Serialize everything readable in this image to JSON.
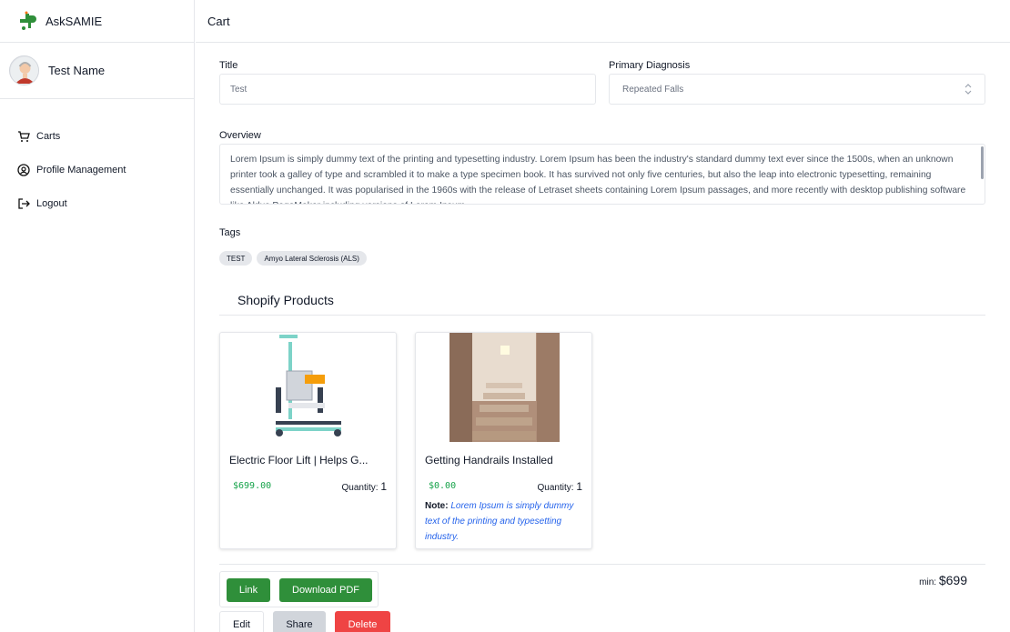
{
  "app": {
    "name": "AskSAMIE"
  },
  "user": {
    "name": "Test Name"
  },
  "nav": [
    {
      "label": "Carts",
      "icon": "cart-icon"
    },
    {
      "label": "Profile Management",
      "icon": "user-circle-icon"
    },
    {
      "label": "Logout",
      "icon": "logout-icon"
    }
  ],
  "header": {
    "title": "Cart"
  },
  "form": {
    "title_label": "Title",
    "title_value": "Test",
    "diagnosis_label": "Primary Diagnosis",
    "diagnosis_value": "Repeated Falls",
    "overview_label": "Overview",
    "overview_text": "Lorem Ipsum is simply dummy text of the printing and typesetting industry. Lorem Ipsum has been the industry's standard dummy text ever since the 1500s, when an unknown printer took a galley of type and scrambled it to make a type specimen book. It has survived not only five centuries, but also the leap into electronic typesetting, remaining essentially unchanged. It was popularised in the 1960s with the release of Letraset sheets containing Lorem Ipsum passages, and more recently with desktop publishing software like Aldus PageMaker including versions of Lorem Ipsum.",
    "tags_label": "Tags",
    "tags": [
      "TEST",
      "Amyo Lateral Sclerosis (ALS)"
    ]
  },
  "products": {
    "section_title": "Shopify Products",
    "quantity_label": "Quantity:",
    "note_label": "Note:",
    "items": [
      {
        "title": "Electric Floor Lift | Helps G...",
        "price": "$699.00",
        "quantity": "1",
        "note": ""
      },
      {
        "title": "Getting Handrails Installed",
        "price": "$0.00",
        "quantity": "1",
        "note": "Lorem Ipsum is simply dummy text of the printing and typesetting industry."
      }
    ]
  },
  "actions": {
    "link": "Link",
    "download_pdf": "Download PDF",
    "edit": "Edit",
    "share": "Share",
    "delete": "Delete"
  },
  "summary": {
    "min_label": "min:",
    "min_value": "$699"
  },
  "colors": {
    "accent_green": "#2f8f3a",
    "price_green": "#16a34a",
    "danger": "#ef4444",
    "note_blue": "#2563eb"
  }
}
